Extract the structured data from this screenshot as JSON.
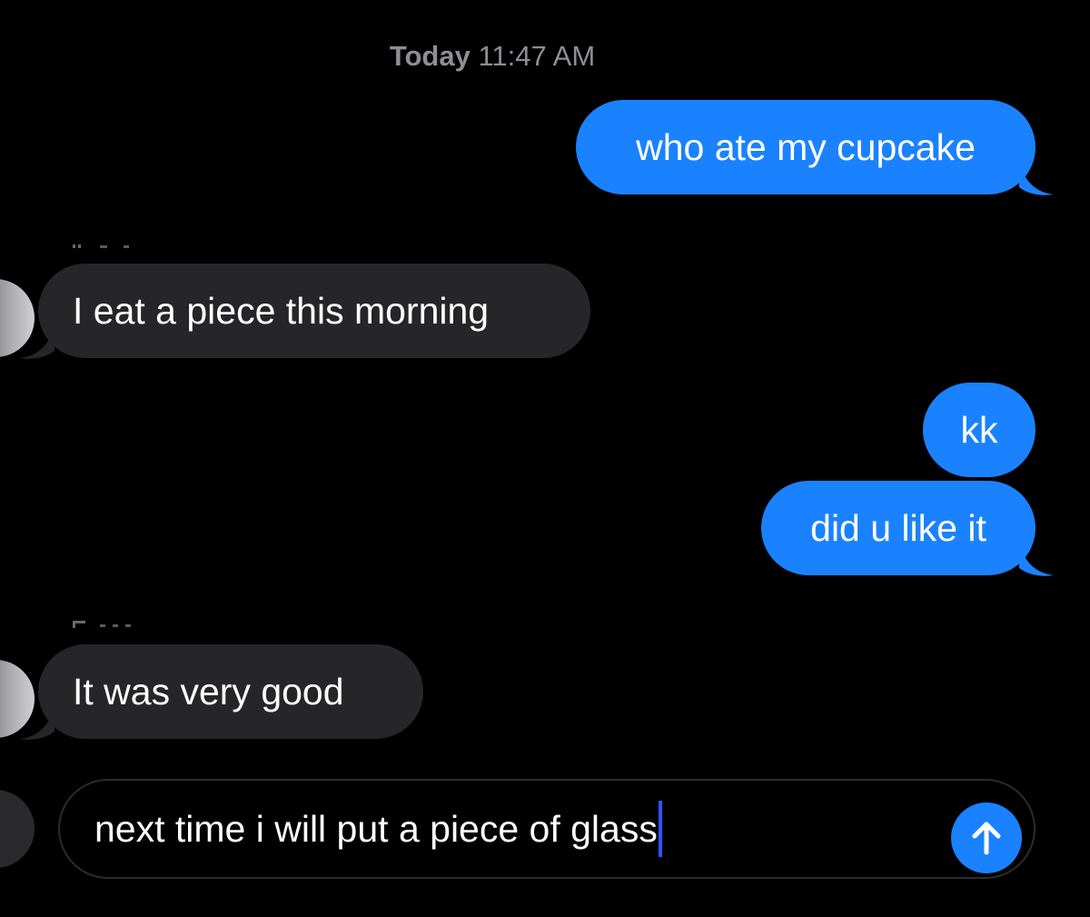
{
  "conversation": {
    "timestamp": {
      "day": "Today",
      "time": "11:47 AM"
    },
    "messages": [
      {
        "direction": "outgoing",
        "text": "who ate my cupcake"
      },
      {
        "direction": "incoming",
        "text": "I eat a piece this morning"
      },
      {
        "direction": "outgoing",
        "text": "kk"
      },
      {
        "direction": "outgoing",
        "text": "did u like it"
      },
      {
        "direction": "incoming",
        "text": "It was very good"
      }
    ]
  },
  "composer": {
    "value": "next time i will put a piece of glass",
    "send_icon": "arrow-up-icon"
  },
  "colors": {
    "background": "#000000",
    "outgoing_bubble": "#1a82ff",
    "incoming_bubble": "#262628",
    "timestamp_text": "#8e8e93",
    "caret": "#2f56ff"
  }
}
